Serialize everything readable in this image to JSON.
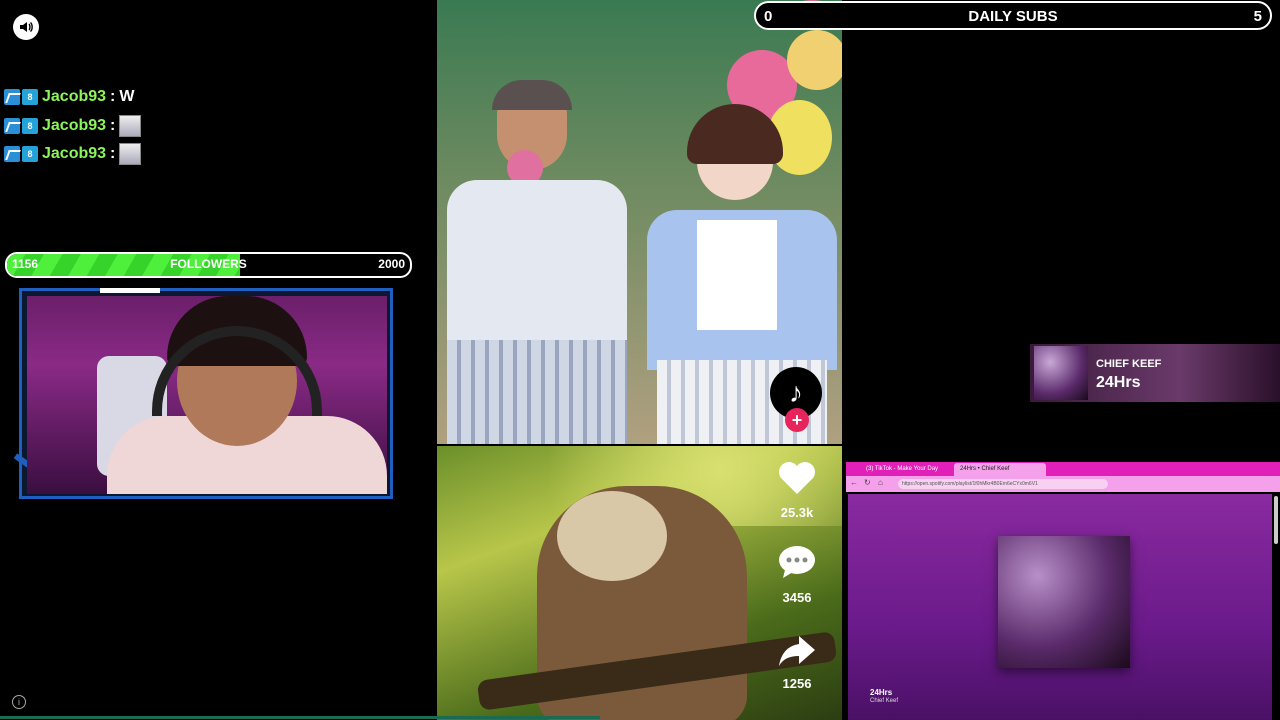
{
  "chat": {
    "messages": [
      {
        "user": "Jacob93",
        "sep": ":",
        "text": "W",
        "emote": false
      },
      {
        "user": "Jacob93",
        "sep": ":",
        "text": "",
        "emote": true
      },
      {
        "user": "Jacob93",
        "sep": ":",
        "text": "",
        "emote": true
      }
    ],
    "badge_text": "8"
  },
  "followers_goal": {
    "current": "1156",
    "label": "FOLLOWERS",
    "target": "2000",
    "progress_fraction": 0.578
  },
  "daily_subs": {
    "current": "0",
    "label": "DAILY SUBS",
    "target": "5"
  },
  "video_stats": {
    "likes": "25.3k",
    "comments": "3456",
    "shares": "1256"
  },
  "now_playing": {
    "artist": "CHIEF KEEF",
    "title": "24Hrs"
  },
  "browser": {
    "tab1": "(3) TikTok - Make Your Day",
    "tab2": "24Hrs • Chief Keef",
    "url": "https://open.spotify.com/playlist/1f0hMkr4B0Em6eCYx0m6V1",
    "song": "24Hrs",
    "artist": "Chief Keef"
  },
  "icons": {
    "volume": "volume-icon",
    "tiktok": "tiktok-logo-icon",
    "heart": "heart-icon",
    "comment": "comment-icon",
    "share": "share-icon",
    "info": "info-icon"
  },
  "colors": {
    "chat_user": "#8cf55a",
    "followers_fill": "#4ef03c",
    "browser_accent": "#e020b8",
    "tiktok_plus": "#e8245c"
  }
}
